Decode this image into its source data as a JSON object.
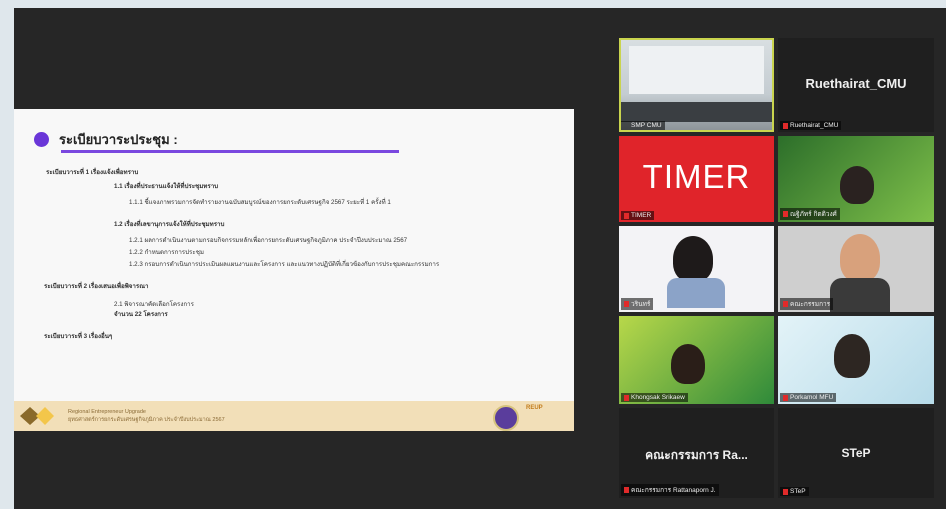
{
  "slide": {
    "title": "ระเบียบวาระประชุม :",
    "agenda": [
      {
        "text": "ระเบียบวาระที่ 1 เรื่องแจ้งเพื่อทราบ",
        "bold": true
      },
      {
        "text": "1.1 เรื่องที่ประธานแจ้งให้ที่ประชุมทราบ",
        "bold": true
      },
      {
        "text": "1.1.1 ชี้แจงภาพรวมการจัดทำรายงานฉบับสมบูรณ์ของการยกระดับเศรษฐกิจ 2567 ระยะที่ 1 ครั้งที่ 1",
        "bold": false
      },
      {
        "text": "1.2 เรื่องที่เลขานุการแจ้งให้ที่ประชุมทราบ",
        "bold": true
      },
      {
        "text": "1.2.1 ผลการดำเนินงานตามกรอบกิจกรรมหลักเพื่อการยกระดับเศรษฐกิจภูมิภาค ประจำปีงบประมาณ 2567",
        "bold": false
      },
      {
        "text": "1.2.2 กำหนดการการประชุม",
        "bold": false
      },
      {
        "text": "1.2.3 กรอบการดำเนินการประเมินผลแผนงานและโครงการ และแนวทางปฏิบัติที่เกี่ยวข้องกับการประชุมคณะกรรมการ",
        "bold": false
      },
      {
        "text": "ระเบียบวาระที่ 2 เรื่องเสนอเพื่อพิจารณา",
        "bold": true
      },
      {
        "text": "2.1 พิจารณาคัดเลือกโครงการ",
        "bold": false
      },
      {
        "text": "จำนวน 22 โครงการ",
        "bold": true
      },
      {
        "text": "ระเบียบวาระที่ 3 เรื่องอื่นๆ",
        "bold": true
      }
    ],
    "footer_line1": "Regional Entrepreneur Upgrade",
    "footer_line2": "ยุทธศาสตร์การยกระดับเศรษฐกิจภูมิภาค ประจำปีงบประมาณ 2567",
    "footer_brand": "REUP"
  },
  "participants": [
    {
      "label": "SMP CMU",
      "kind": "video"
    },
    {
      "label": "Ruethairat_CMU",
      "display": "Ruethairat_CMU",
      "kind": "name"
    },
    {
      "label": "TIMER",
      "display": "TIMER",
      "kind": "timer",
      "color": "#e0242a"
    },
    {
      "label": "ณฐิภัทร์ กิตติวงศ์",
      "kind": "video"
    },
    {
      "label": "วรินทร์",
      "kind": "video"
    },
    {
      "label": "คณะกรรมการ",
      "kind": "video"
    },
    {
      "label": "Khongsak Srikaew",
      "kind": "video"
    },
    {
      "label": "Porkamol MFU",
      "kind": "video"
    },
    {
      "label": "คณะกรรมการ Rattanaporn J.",
      "display": "คณะกรรมการ Ra...",
      "kind": "name"
    },
    {
      "label": "STeP",
      "display": "STeP",
      "kind": "name"
    }
  ],
  "colors": {
    "muted_icon": "#e02a2a",
    "active_speaker": "#c9d44e",
    "accent": "#6a36d8"
  },
  "icons": {
    "muted": "mic-off-icon"
  }
}
